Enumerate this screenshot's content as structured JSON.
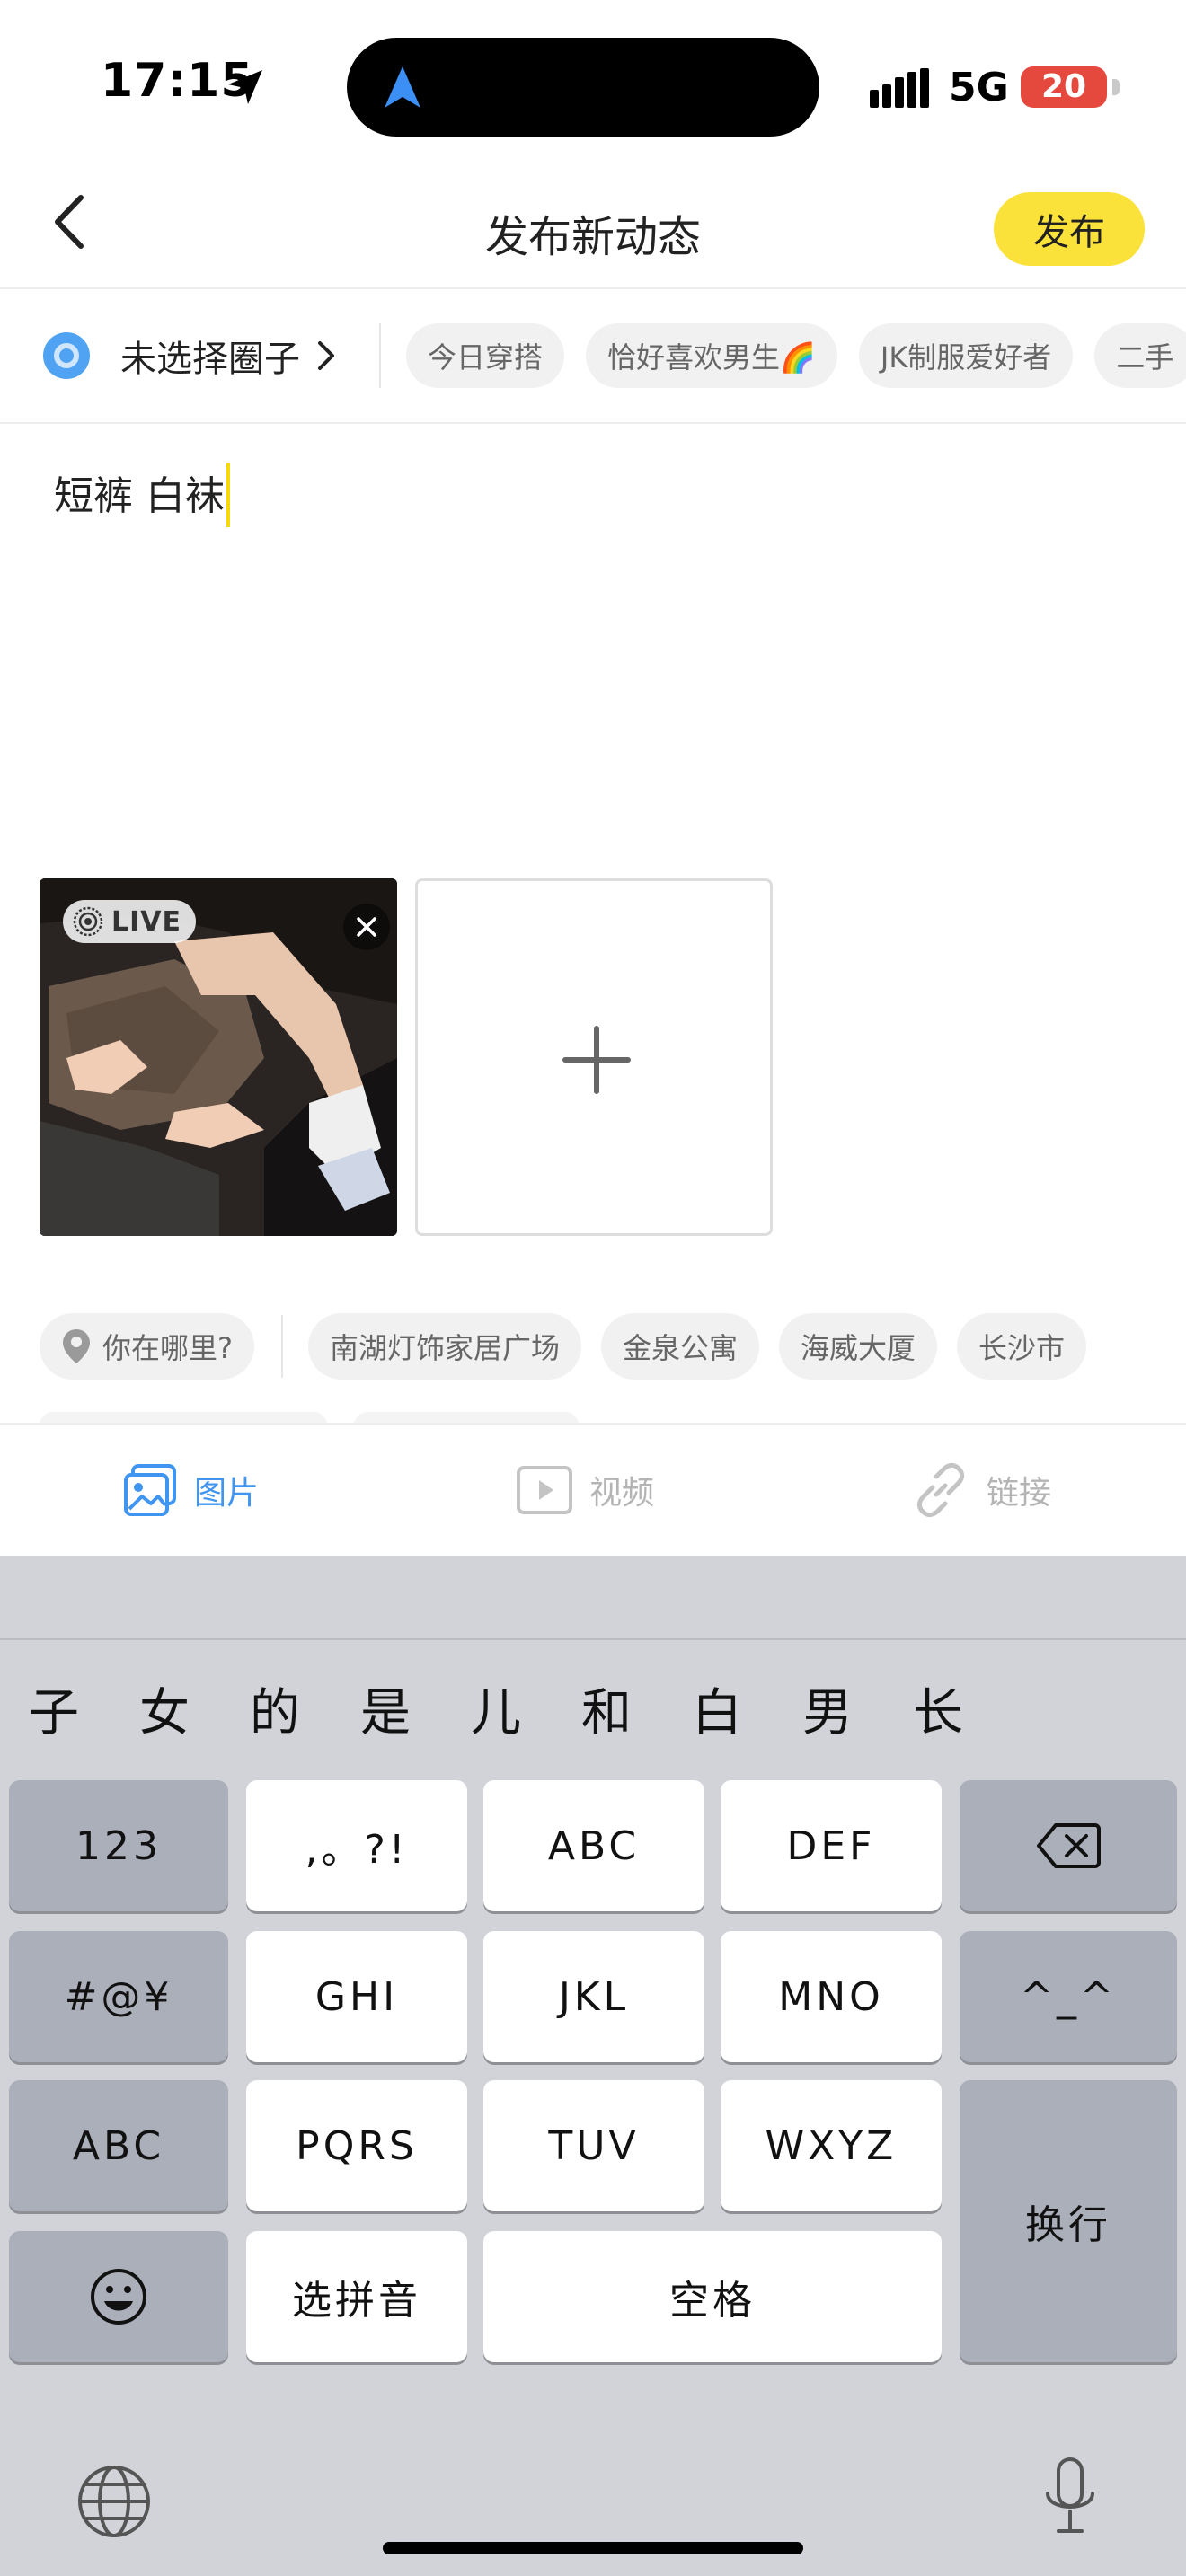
{
  "status_bar": {
    "time": "17:15",
    "network": "5G",
    "battery": "20",
    "icons": [
      "location-arrow-icon",
      "navigation-arrow-icon",
      "signal-icon"
    ]
  },
  "header": {
    "title": "发布新动态",
    "publish_label": "发布",
    "back_icon": "back-chevron-icon"
  },
  "circle": {
    "select_label": "未选择圈子",
    "chips": [
      "今日穿搭",
      "恰好喜欢男生🌈",
      "JK制服爱好者",
      "二手"
    ]
  },
  "post": {
    "text": "短裤 白袜"
  },
  "media": {
    "live_label": "LIVE",
    "add_icon": "plus-icon"
  },
  "location": {
    "placeholder": "你在哪里?",
    "suggestions": [
      "南湖灯饰家居广场",
      "金泉公寓",
      "海威大厦",
      "长沙市"
    ]
  },
  "media_tabs": [
    {
      "label": "图片",
      "icon": "image-icon",
      "active": true
    },
    {
      "label": "视频",
      "icon": "video-icon",
      "active": false
    },
    {
      "label": "链接",
      "icon": "link-icon",
      "active": false
    }
  ],
  "keyboard": {
    "candidates": [
      "子",
      "女",
      "的",
      "是",
      "儿",
      "和",
      "白",
      "男",
      "长"
    ],
    "keys": {
      "num": "123",
      "punct": ",。?!",
      "abc2": "ABC",
      "def": "DEF",
      "symbols": "#@¥",
      "ghi": "GHI",
      "jkl": "JKL",
      "mno": "MNO",
      "emoticon": "^_^",
      "abc_switch": "ABC",
      "pqrs": "PQRS",
      "tuv": "TUV",
      "wxyz": "WXYZ",
      "return": "换行",
      "pinyin": "选拼音",
      "space": "空格"
    }
  },
  "colors": {
    "accent_yellow": "#fbe23a",
    "accent_blue": "#4fa3f2",
    "battery_red": "#e5483c",
    "keyboard_bg": "#d1d3d9"
  }
}
